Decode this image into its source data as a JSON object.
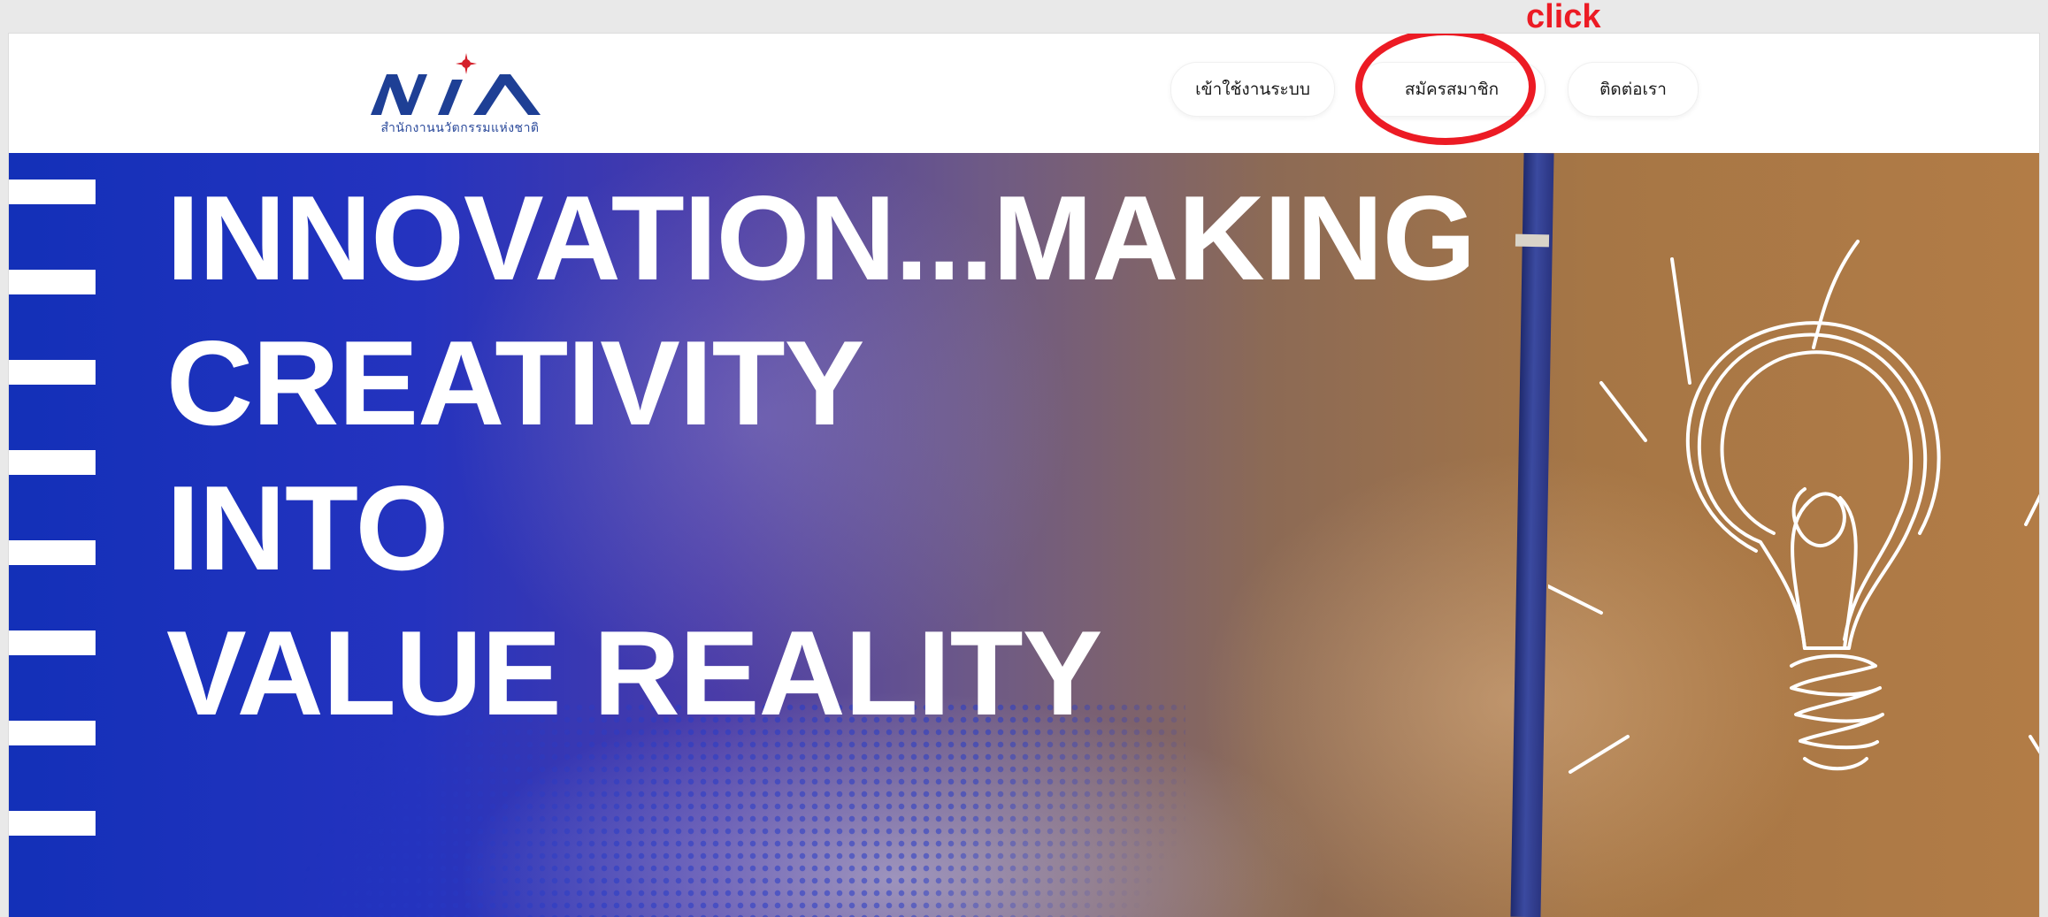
{
  "header": {
    "logo_text": "NIA",
    "logo_subtitle": "สำนักงานนวัตกรรมแห่งชาติ",
    "nav": {
      "login": "เข้าใช้งานระบบ",
      "register": "สมัครสมาชิก",
      "contact": "ติดต่อเรา"
    }
  },
  "annotation": {
    "label": "click",
    "color": "#ec1b24"
  },
  "hero": {
    "headline": [
      "INNOVATION...MAKING",
      "CREATIVITY",
      "INTO",
      "VALUE REALITY"
    ],
    "slide_count": 3,
    "active_slide": 1
  },
  "colors": {
    "brand_blue": "#1330b8",
    "logo_blue": "#1e3f95",
    "logo_star": "#d4202b"
  }
}
